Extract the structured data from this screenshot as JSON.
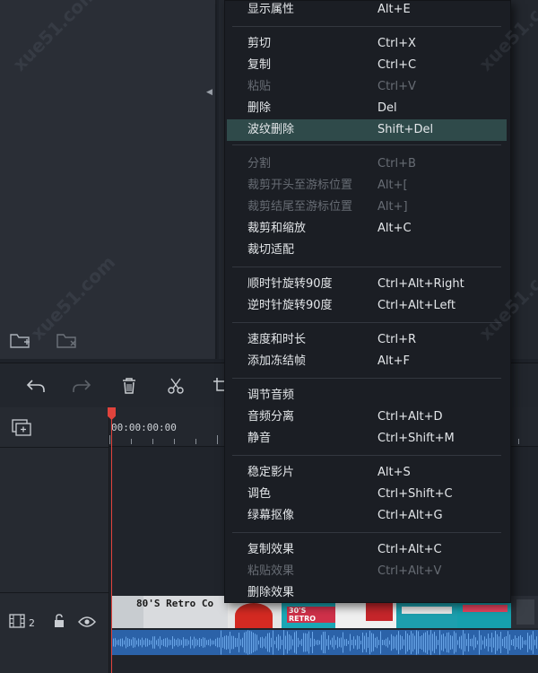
{
  "context_menu": {
    "items": [
      {
        "label": "显示属性",
        "shortcut": "Alt+E",
        "disabled": false
      },
      {
        "label": "剪切",
        "shortcut": "Ctrl+X",
        "disabled": false
      },
      {
        "label": "复制",
        "shortcut": "Ctrl+C",
        "disabled": false
      },
      {
        "label": "粘贴",
        "shortcut": "Ctrl+V",
        "disabled": true
      },
      {
        "label": "删除",
        "shortcut": "Del",
        "disabled": false
      },
      {
        "label": "波纹删除",
        "shortcut": "Shift+Del",
        "disabled": false,
        "highlighted": true
      },
      {
        "label": "分割",
        "shortcut": "Ctrl+B",
        "disabled": true
      },
      {
        "label": "裁剪开头至游标位置",
        "shortcut": "Alt+[",
        "disabled": true
      },
      {
        "label": "裁剪结尾至游标位置",
        "shortcut": "Alt+]",
        "disabled": true
      },
      {
        "label": "裁剪和缩放",
        "shortcut": "Alt+C",
        "disabled": false
      },
      {
        "label": "裁切适配",
        "shortcut": "",
        "disabled": false
      },
      {
        "label": "顺时针旋转90度",
        "shortcut": "Ctrl+Alt+Right",
        "disabled": false
      },
      {
        "label": "逆时针旋转90度",
        "shortcut": "Ctrl+Alt+Left",
        "disabled": false
      },
      {
        "label": "速度和时长",
        "shortcut": "Ctrl+R",
        "disabled": false
      },
      {
        "label": "添加冻结帧",
        "shortcut": "Alt+F",
        "disabled": false
      },
      {
        "label": "调节音频",
        "shortcut": "",
        "disabled": false
      },
      {
        "label": "音频分离",
        "shortcut": "Ctrl+Alt+D",
        "disabled": false
      },
      {
        "label": "静音",
        "shortcut": "Ctrl+Shift+M",
        "disabled": false
      },
      {
        "label": "稳定影片",
        "shortcut": "Alt+S",
        "disabled": false
      },
      {
        "label": "调色",
        "shortcut": "Ctrl+Shift+C",
        "disabled": false
      },
      {
        "label": "绿幕抠像",
        "shortcut": "Ctrl+Alt+G",
        "disabled": false
      },
      {
        "label": "复制效果",
        "shortcut": "Ctrl+Alt+C",
        "disabled": false
      },
      {
        "label": "粘贴效果",
        "shortcut": "Ctrl+Alt+V",
        "disabled": true
      },
      {
        "label": "删除效果",
        "shortcut": "",
        "disabled": false
      }
    ]
  },
  "timeline": {
    "timecode": "00:00:00:00",
    "track_number": "2",
    "clip_title": "80'S Retro Co",
    "thumb_labels": [
      "30'S RETRO"
    ]
  },
  "icons": {
    "new_folder": "folder-plus-icon",
    "remove_folder": "folder-x-icon",
    "undo": "undo-icon",
    "redo": "redo-icon",
    "delete": "trash-icon",
    "cut": "scissors-icon",
    "crop": "crop-icon",
    "add_track": "add-track-icon",
    "track_type": "film-icon",
    "lock": "lock-icon",
    "visibility": "eye-icon"
  },
  "colors": {
    "menu_highlight": "#2f4a4a",
    "playhead": "#e0433c",
    "audio_wave": "#2b62a8"
  }
}
